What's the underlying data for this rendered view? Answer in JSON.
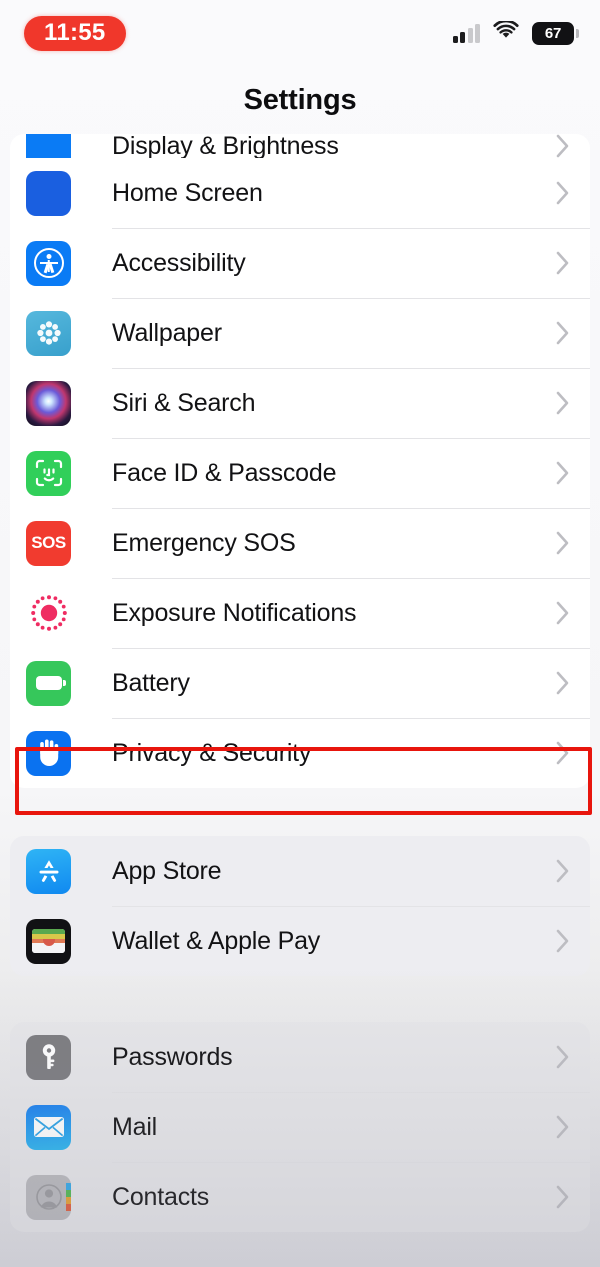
{
  "status_bar": {
    "time": "11:55",
    "recording_indicator": true,
    "recording_color": "#f0372b",
    "battery_level": "67",
    "signal_icon": "cellular-bars-icon",
    "wifi_icon": "wifi-icon",
    "battery_icon": "battery-icon"
  },
  "nav": {
    "title": "Settings"
  },
  "highlight": {
    "color": "#e8150d",
    "target": "Privacy & Security"
  },
  "sections": [
    {
      "id": "system",
      "partial_top_row": {
        "label": "Display & Brightness",
        "icon": "display-brightness-icon"
      },
      "rows": [
        {
          "label": "Home Screen",
          "icon": "home-screen-icon",
          "chevron": "chevron-right-icon"
        },
        {
          "label": "Accessibility",
          "icon": "accessibility-icon",
          "chevron": "chevron-right-icon"
        },
        {
          "label": "Wallpaper",
          "icon": "wallpaper-icon",
          "chevron": "chevron-right-icon"
        },
        {
          "label": "Siri & Search",
          "icon": "siri-icon",
          "chevron": "chevron-right-icon"
        },
        {
          "label": "Face ID & Passcode",
          "icon": "face-id-icon",
          "chevron": "chevron-right-icon"
        },
        {
          "label": "Emergency SOS",
          "icon": "emergency-sos-icon",
          "chevron": "chevron-right-icon"
        },
        {
          "label": "Exposure Notifications",
          "icon": "exposure-notifications-icon",
          "chevron": "chevron-right-icon"
        },
        {
          "label": "Battery",
          "icon": "battery-settings-icon",
          "chevron": "chevron-right-icon"
        },
        {
          "label": "Privacy & Security",
          "icon": "privacy-security-icon",
          "chevron": "chevron-right-icon",
          "highlighted": true
        }
      ]
    },
    {
      "id": "store",
      "rows": [
        {
          "label": "App Store",
          "icon": "app-store-icon",
          "chevron": "chevron-right-icon"
        },
        {
          "label": "Wallet & Apple Pay",
          "icon": "wallet-icon",
          "chevron": "chevron-right-icon"
        }
      ]
    },
    {
      "id": "accounts",
      "rows": [
        {
          "label": "Passwords",
          "icon": "passwords-key-icon",
          "chevron": "chevron-right-icon"
        },
        {
          "label": "Mail",
          "icon": "mail-icon",
          "chevron": "chevron-right-icon"
        },
        {
          "label": "Contacts",
          "icon": "contacts-icon",
          "chevron": "chevron-right-icon"
        }
      ]
    }
  ],
  "icon_colors": {
    "home_screen": "#1a5fe0",
    "accessibility": "#0a7bf5",
    "wallpaper": "#3ea3cf",
    "face_id": "#31cf5a",
    "emergency_sos": "#f13b2f",
    "exposure": "#ef2c62",
    "battery": "#36c75b",
    "privacy": "#0a72f0",
    "app_store": "#1089f0",
    "wallet": "#111114",
    "passwords": "#7c7c80",
    "mail": "#1a7ff0",
    "contacts": "#b9b9bd"
  }
}
